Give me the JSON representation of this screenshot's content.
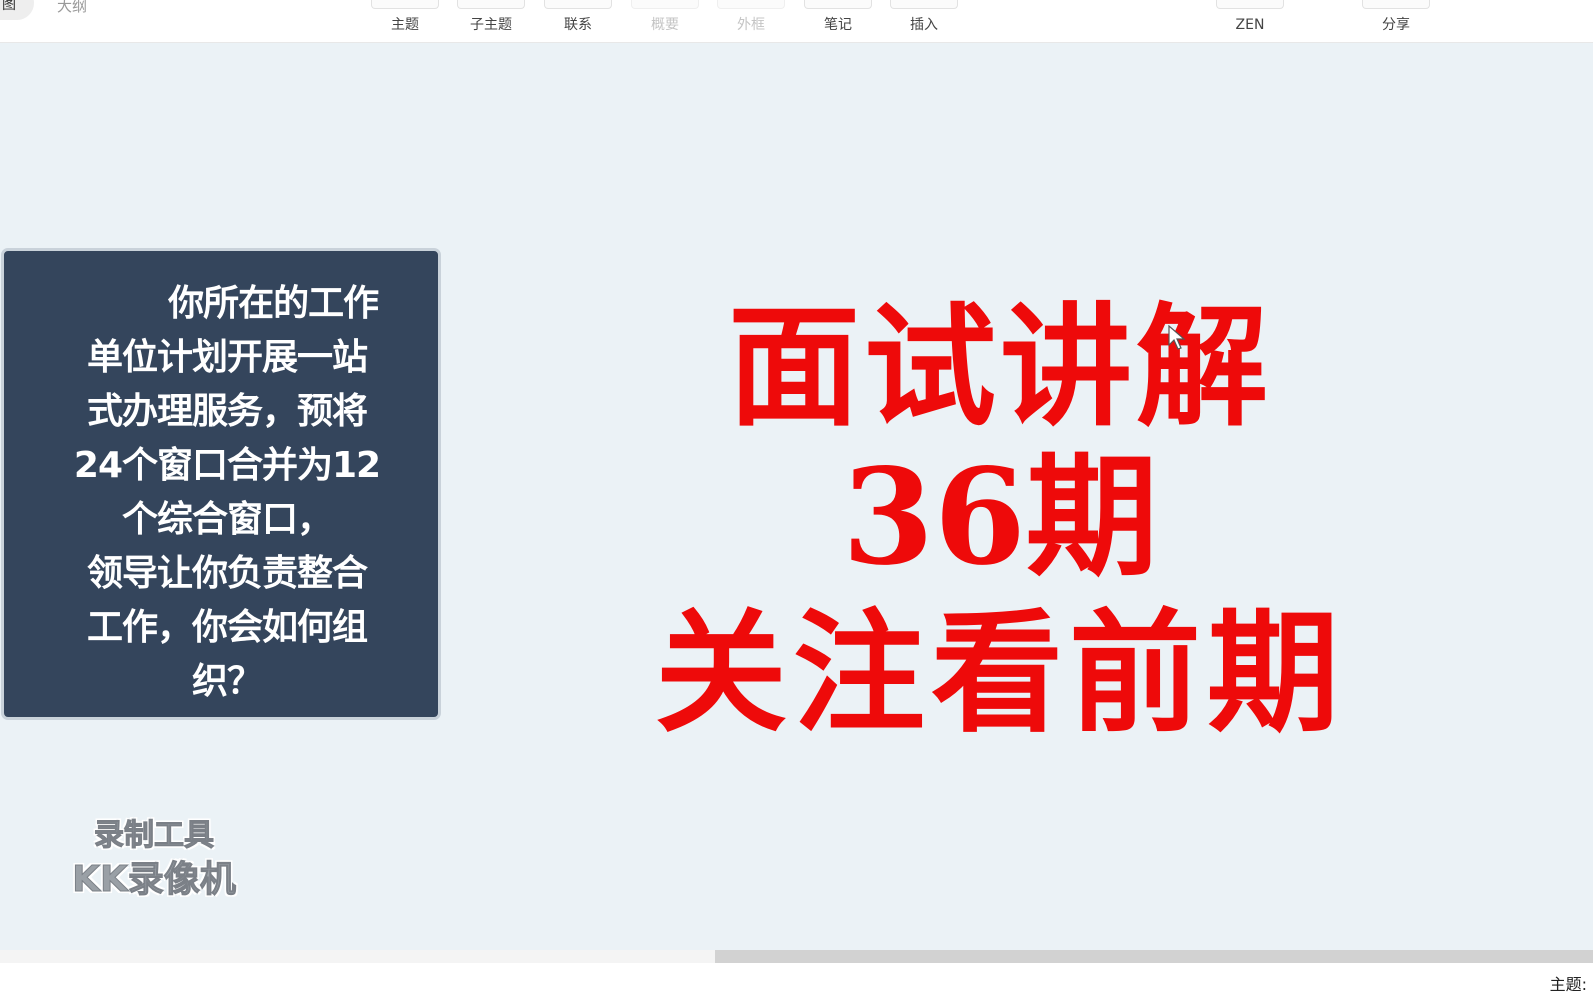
{
  "view_tabs": {
    "active": "图",
    "outline": "大纲"
  },
  "toolbar": [
    {
      "label": "主题",
      "icon": "topic-icon",
      "enabled": true
    },
    {
      "label": "子主题",
      "icon": "subtopic-icon",
      "enabled": true
    },
    {
      "label": "联系",
      "icon": "relationship-icon",
      "enabled": true
    },
    {
      "label": "概要",
      "icon": "summary-icon",
      "enabled": false
    },
    {
      "label": "外框",
      "icon": "boundary-icon",
      "enabled": false
    },
    {
      "label": "笔记",
      "icon": "note-icon",
      "enabled": true
    },
    {
      "label": "插入",
      "icon": "insert-icon",
      "enabled": true
    },
    {
      "label": "ZEN",
      "icon": "zen-icon",
      "enabled": true
    },
    {
      "label": "分享",
      "icon": "share-icon",
      "enabled": true
    }
  ],
  "topic": {
    "text": "        你所在的工作\n单位计划开展一站\n式办理服务，预将\n24个窗口合并为12\n个综合窗口，\n领导让你负责整合\n工作，你会如何组\n织？"
  },
  "promo": {
    "line1": "面试讲解",
    "line2": "36期",
    "line3": "关注看前期",
    "color": "#ee0a0a"
  },
  "watermark": {
    "line1": "录制工具",
    "line2": "KK录像机"
  },
  "status": {
    "label": "主题:"
  },
  "colors": {
    "canvas": "#ebf2f6",
    "topic_fill": "#34455c",
    "topic_border": "#c9d2da"
  }
}
